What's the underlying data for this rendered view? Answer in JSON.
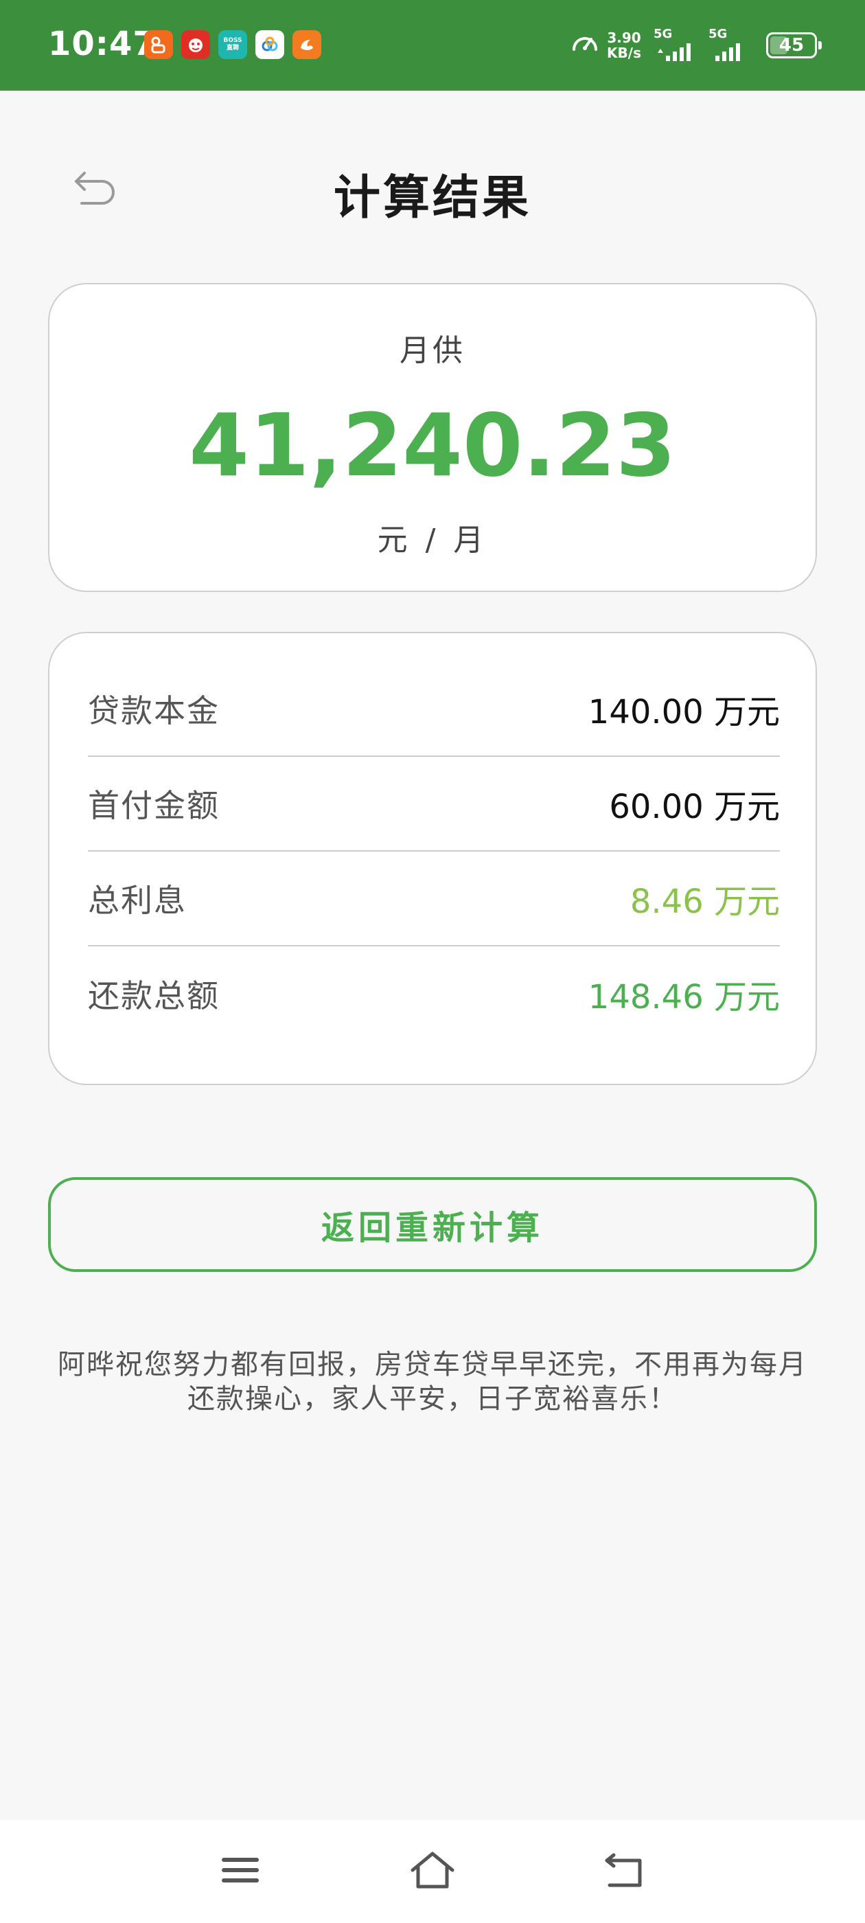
{
  "status_bar": {
    "time": "10:47",
    "app_icons": [
      {
        "name": "kuaishou-app-icon",
        "label": "",
        "color": "#f26b1d"
      },
      {
        "name": "pinduoduo-app-icon",
        "label": "",
        "color": "#e02e24"
      },
      {
        "name": "boss-zhipin-app-icon",
        "label": "BOSS\n直聘",
        "color": "#1fb6b0"
      },
      {
        "name": "baidu-netdisk-app-icon",
        "label": "",
        "color": "#ffffff"
      },
      {
        "name": "uc-browser-app-icon",
        "label": "",
        "color": "#f47b20"
      }
    ],
    "speed_value": "3.90",
    "speed_unit": "KB/s",
    "network_1": "5G",
    "network_2": "5G",
    "battery": "45",
    "battery_level": 0.45,
    "background": "#3c8f3c"
  },
  "header": {
    "title": "计算结果"
  },
  "monthly": {
    "label": "月供",
    "amount": "41,240.23",
    "unit": "元 / 月"
  },
  "details": {
    "rows": [
      {
        "label": "贷款本金",
        "value": "140.00 万元",
        "color": "#111111"
      },
      {
        "label": "首付金额",
        "value": "60.00 万元",
        "color": "#111111"
      },
      {
        "label": "总利息",
        "value": "8.46 万元",
        "color": "#8bc34a"
      },
      {
        "label": "还款总额",
        "value": "148.46 万元",
        "color": "#4caf50"
      }
    ]
  },
  "actions": {
    "recalculate": "返回重新计算"
  },
  "blessing": {
    "line1": "阿晔祝您努力都有回报，房贷车贷早早还完，不用再为每月",
    "line2": "还款操心，家人平安，日子宽裕喜乐！"
  },
  "colors": {
    "accent": "#4caf50",
    "accent_light": "#8bc34a",
    "background": "#f7f7f7"
  }
}
